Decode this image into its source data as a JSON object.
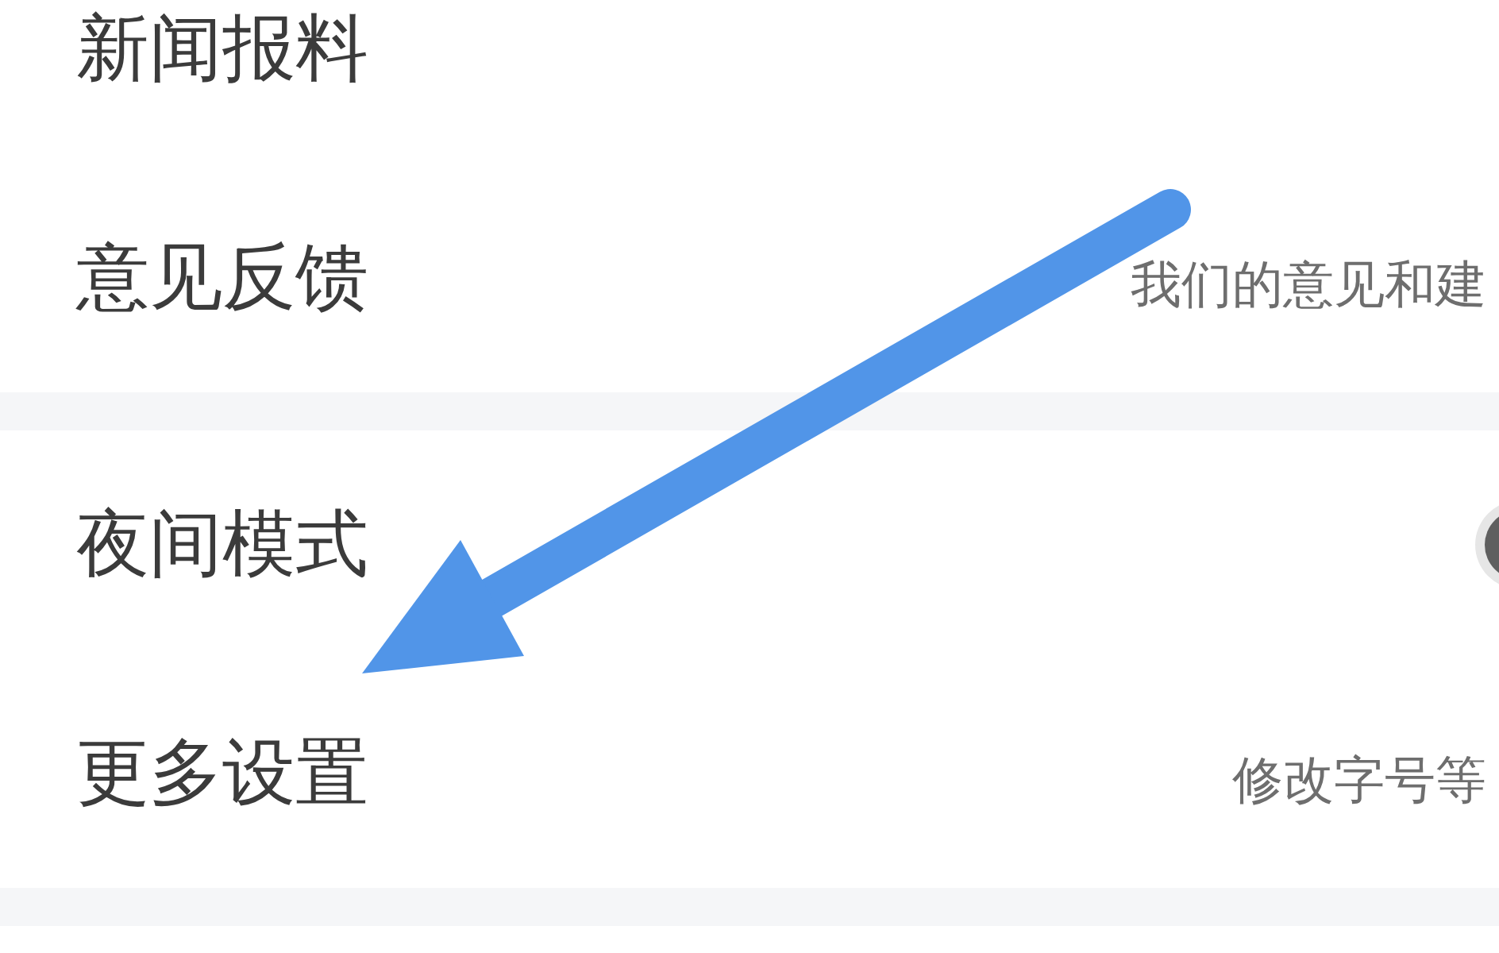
{
  "sections": [
    {
      "rows": [
        {
          "kind": "link",
          "label": "新闻报料"
        },
        {
          "kind": "link",
          "label": "意见反馈",
          "hint": "我们的意见和建"
        }
      ]
    },
    {
      "rows": [
        {
          "kind": "switch",
          "label": "夜间模式",
          "on": false
        },
        {
          "kind": "link",
          "label": "更多设置",
          "hint": "修改字号等"
        }
      ]
    }
  ]
}
